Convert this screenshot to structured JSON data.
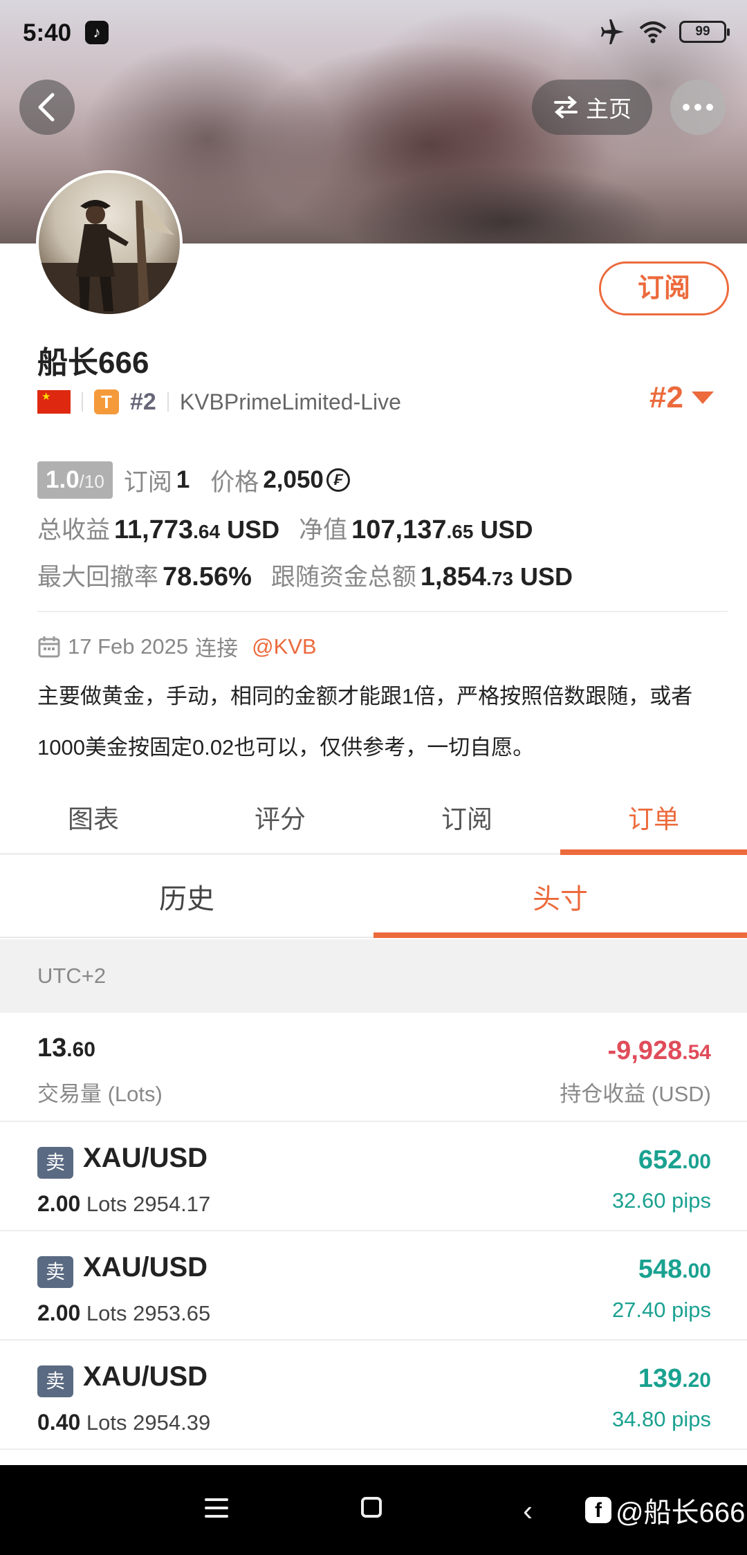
{
  "status_bar": {
    "time": "5:40",
    "battery": "99"
  },
  "header": {
    "home_label": "主页"
  },
  "profile": {
    "name": "船长666",
    "subscribe_label": "订阅",
    "t_badge": "T",
    "rank_small": "#2",
    "server": "KVBPrimeLimited-Live",
    "rank_big": "#2",
    "level_value": "1.0",
    "level_max": "/10",
    "subs_label": "订阅",
    "subs_value": "1",
    "price_label": "价格",
    "price_value": "2,050",
    "coin_symbol": "₣",
    "total_profit_label": "总收益",
    "total_profit_int": "11,773",
    "total_profit_dec": ".64",
    "total_profit_unit": "USD",
    "equity_label": "净值",
    "equity_int": "107,137",
    "equity_dec": ".65",
    "equity_unit": "USD",
    "drawdown_label": "最大回撤率",
    "drawdown_value": "78.56%",
    "follow_funds_label": "跟随资金总额",
    "follow_funds_int": "1,854",
    "follow_funds_dec": ".73",
    "follow_funds_unit": "USD",
    "joined_date": "17 Feb 2025",
    "joined_label": "连接",
    "joined_broker": "@KVB",
    "bio": "主要做黄金，手动，相同的金额才能跟1倍，严格按照倍数跟随，或者1000美金按固定0.02也可以，仅供参考，一切自愿。"
  },
  "tabs": [
    {
      "label": "图表",
      "active": false
    },
    {
      "label": "评分",
      "active": false
    },
    {
      "label": "订阅",
      "active": false
    },
    {
      "label": "订单",
      "active": true
    }
  ],
  "subtabs": [
    {
      "label": "历史",
      "active": false
    },
    {
      "label": "头寸",
      "active": true
    }
  ],
  "timezone": "UTC+2",
  "summary": {
    "lots_int": "13",
    "lots_dec": ".60",
    "lots_label": "交易量 (Lots)",
    "pnl_int": "-9,928",
    "pnl_dec": ".54",
    "pnl_label": "持仓收益 (USD)"
  },
  "positions": [
    {
      "side": "卖",
      "symbol": "XAU/USD",
      "lots": "2.00",
      "lots_unit": "Lots",
      "price": "2954.17",
      "profit_int": "652",
      "profit_dec": ".00",
      "pips": "32.60 pips"
    },
    {
      "side": "卖",
      "symbol": "XAU/USD",
      "lots": "2.00",
      "lots_unit": "Lots",
      "price": "2953.65",
      "profit_int": "548",
      "profit_dec": ".00",
      "pips": "27.40 pips"
    },
    {
      "side": "卖",
      "symbol": "XAU/USD",
      "lots": "0.40",
      "lots_unit": "Lots",
      "price": "2954.39",
      "profit_int": "139",
      "profit_dec": ".20",
      "pips": "34.80 pips"
    }
  ],
  "watermark": {
    "fb_glyph": "f",
    "text": "@船长666"
  },
  "colors": {
    "accent": "#ec6a3c",
    "loss": "#e04c5a",
    "profit": "#1aa190",
    "sell_badge": "#5a6a82"
  }
}
